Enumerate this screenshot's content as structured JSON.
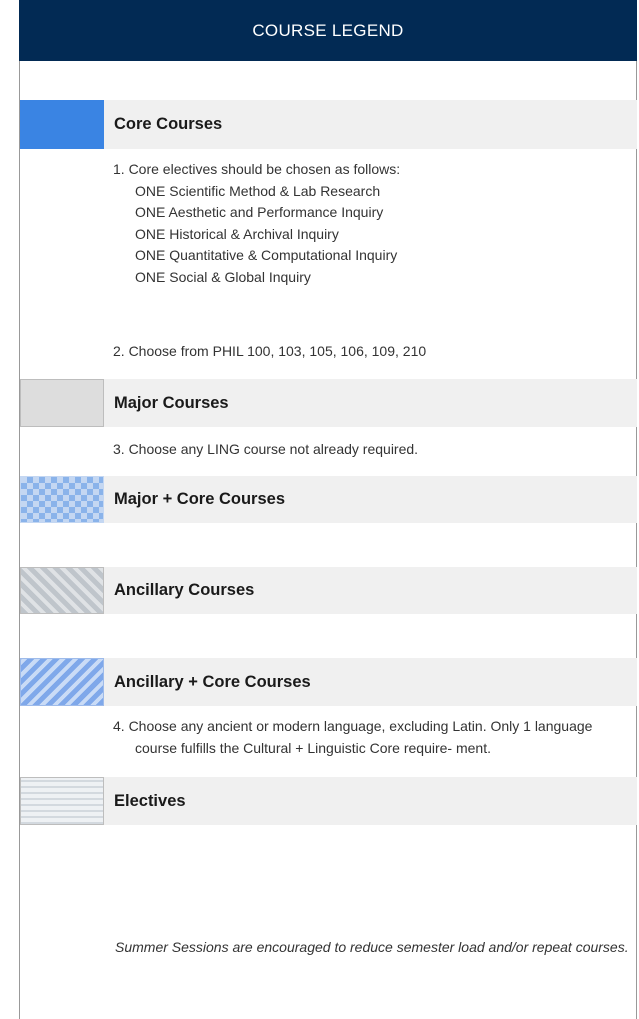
{
  "header": {
    "title": "COURSE LEGEND"
  },
  "legend": [
    {
      "label": "Core Courses"
    },
    {
      "label": "Major Courses"
    },
    {
      "label": "Major + Core Courses"
    },
    {
      "label": "Ancillary Courses"
    },
    {
      "label": "Ancillary + Core Courses"
    },
    {
      "label": "Electives"
    }
  ],
  "notes": {
    "core_intro": "1. Core electives should be chosen as follows:",
    "core_items": [
      "ONE Scientific Method & Lab Research",
      "ONE Aesthetic and Performance Inquiry",
      "ONE Historical & Archival Inquiry",
      "ONE Quantitative & Computational Inquiry",
      "ONE Social & Global Inquiry"
    ],
    "phil": "2.  Choose from PHIL 100, 103, 105, 106, 109, 210",
    "ling": "3. Choose any LING course not already required.",
    "language": "4. Choose any ancient or modern language, excluding Latin. Only 1 language course fulfills the Cultural + Linguistic Core require- ment."
  },
  "footer": {
    "summer": "Summer Sessions are encouraged to reduce semester load and/or repeat courses."
  },
  "colors": {
    "header_bg": "#022a54",
    "core": "#3a84e3",
    "major": "#dddddd",
    "bar_bg": "#f0f0f0"
  }
}
